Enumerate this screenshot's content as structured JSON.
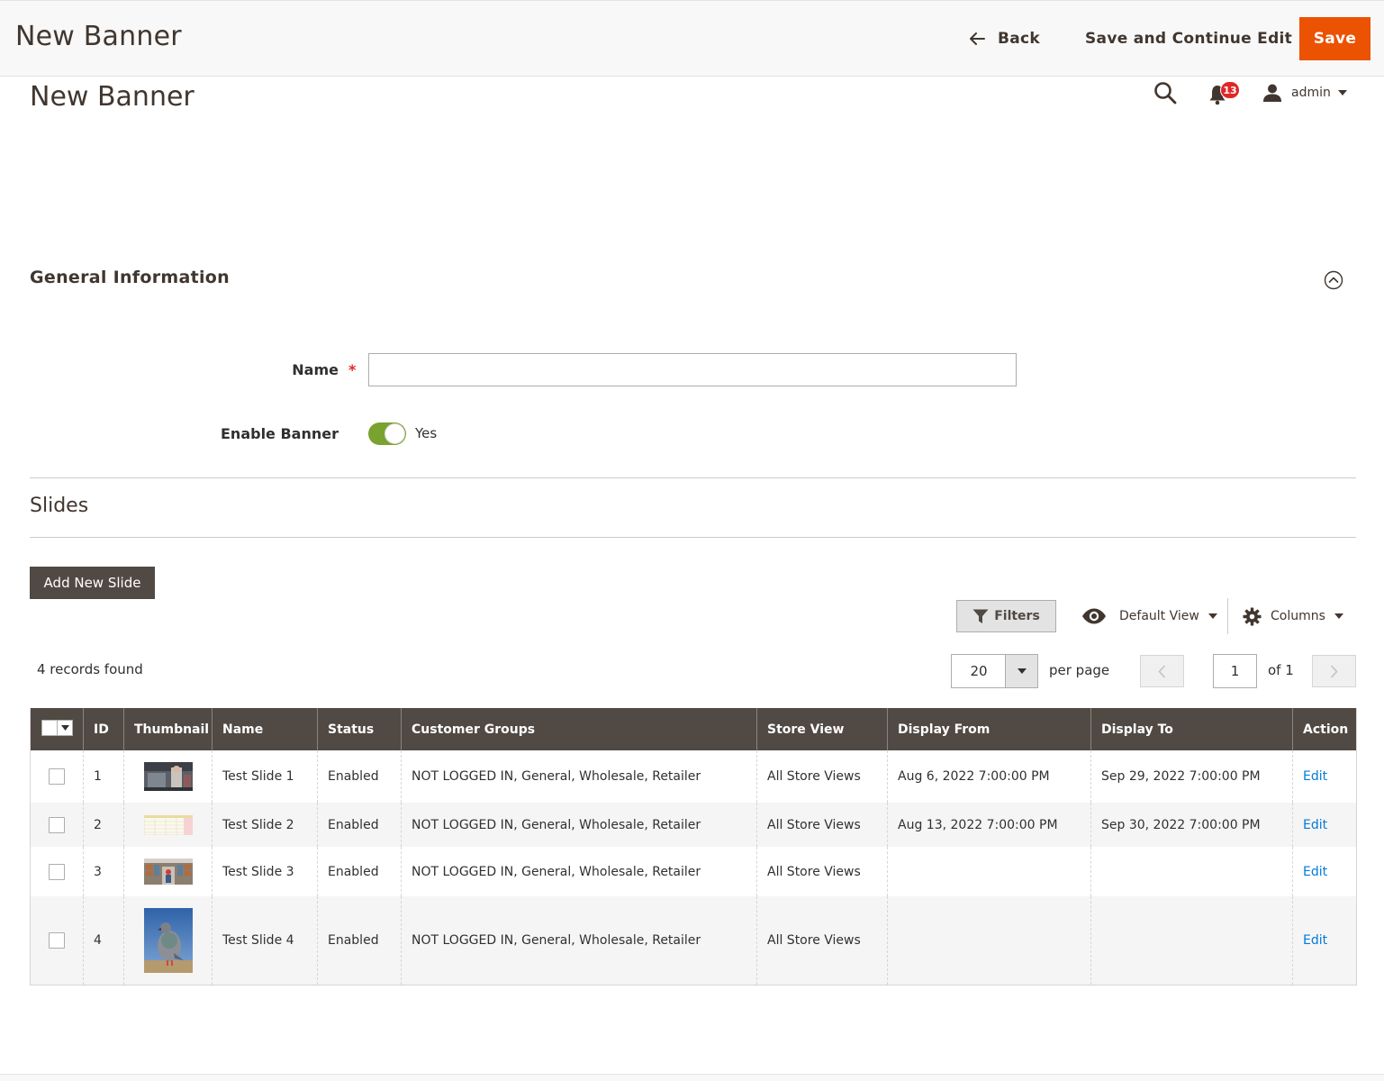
{
  "header": {
    "title": "New Banner",
    "back_label": "Back",
    "save_continue_label": "Save and Continue Edit",
    "save_label": "Save"
  },
  "page_title": "New Banner",
  "actions": {
    "notification_count": "13",
    "user_name": "admin"
  },
  "general": {
    "title": "General Information",
    "name_label": "Name",
    "required_mark": "*",
    "name_value": "",
    "enable_label": "Enable Banner",
    "enable_value": "Yes"
  },
  "slides": {
    "title": "Slides",
    "add_button": "Add New Slide"
  },
  "toolbar": {
    "filters_label": "Filters",
    "default_view_label": "Default View",
    "columns_label": "Columns",
    "records_found": "4 records found",
    "per_page_value": "20",
    "per_page_label": "per page",
    "page_value": "1",
    "page_of": "of 1"
  },
  "grid": {
    "columns": [
      "ID",
      "Thumbnail",
      "Name",
      "Status",
      "Customer Groups",
      "Store View",
      "Display From",
      "Display To",
      "Action"
    ],
    "rows": [
      {
        "id": "1",
        "name": "Test Slide 1",
        "status": "Enabled",
        "groups": "NOT LOGGED IN, General, Wholesale, Retailer",
        "store": "All Store Views",
        "from": "Aug 6, 2022 7:00:00 PM",
        "to": "Sep 29, 2022 7:00:00 PM",
        "action": "Edit"
      },
      {
        "id": "2",
        "name": "Test Slide 2",
        "status": "Enabled",
        "groups": "NOT LOGGED IN, General, Wholesale, Retailer",
        "store": "All Store Views",
        "from": "Aug 13, 2022 7:00:00 PM",
        "to": "Sep 30, 2022 7:00:00 PM",
        "action": "Edit"
      },
      {
        "id": "3",
        "name": "Test Slide 3",
        "status": "Enabled",
        "groups": "NOT LOGGED IN, General, Wholesale, Retailer",
        "store": "All Store Views",
        "from": "",
        "to": "",
        "action": "Edit"
      },
      {
        "id": "4",
        "name": "Test Slide 4",
        "status": "Enabled",
        "groups": "NOT LOGGED IN, General, Wholesale, Retailer",
        "store": "All Store Views",
        "from": "",
        "to": "",
        "action": "Edit"
      }
    ]
  },
  "colors": {
    "accent": "#eb5202",
    "header_dark": "#514943",
    "link": "#007bdb",
    "toggle_on": "#79a22e",
    "badge": "#e22626"
  },
  "icons": [
    "arrow-left-icon",
    "search-icon",
    "bell-icon",
    "user-icon",
    "caret-down-icon",
    "collapse-up-icon",
    "filter-icon",
    "eye-icon",
    "gear-icon",
    "chevron-left-icon",
    "chevron-right-icon"
  ]
}
